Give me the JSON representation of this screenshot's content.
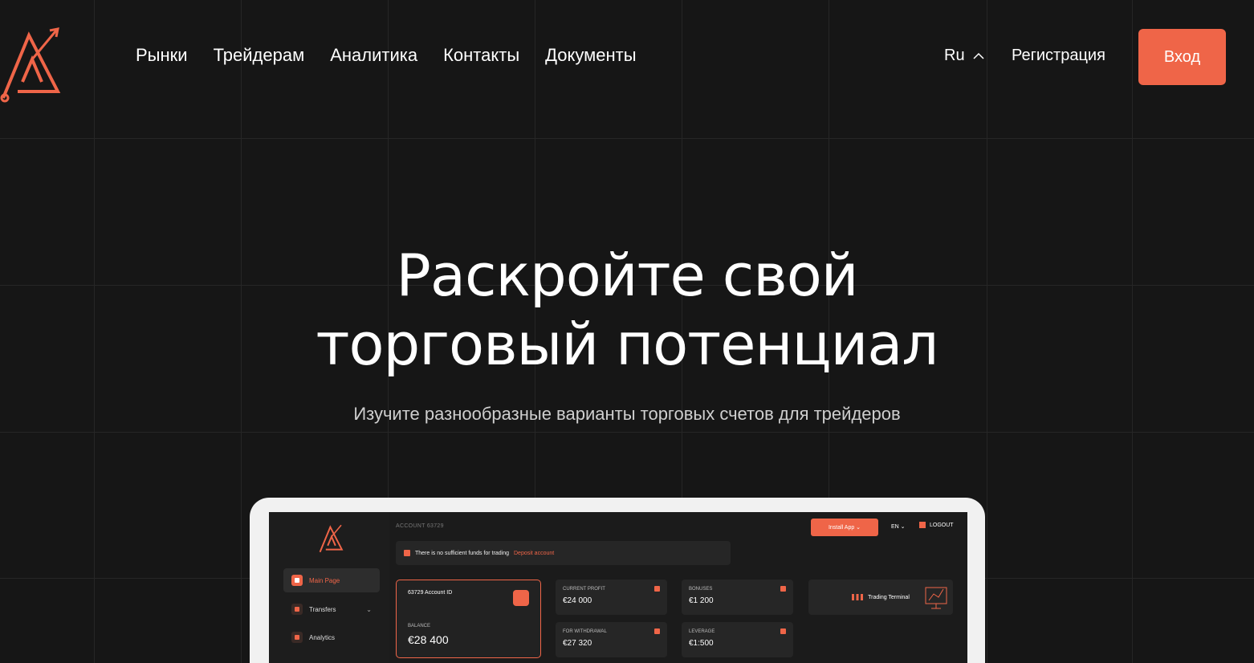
{
  "header": {
    "nav": [
      "Рынки",
      "Трейдерам",
      "Аналитика",
      "Контакты",
      "Документы"
    ],
    "language": "Ru",
    "register_label": "Регистрация",
    "login_label": "Вход"
  },
  "hero": {
    "title_line1": "Раскройте свой",
    "title_line2": "торговый потенциал",
    "subtitle": "Изучите разнообразные варианты торговых счетов для трейдеров"
  },
  "dashboard": {
    "account_label": "ACCOUNT 63729",
    "install_label": "Install App ⌄",
    "language": "EN ⌄",
    "logout_label": "LOGOUT",
    "warning_text": "There is no sufficient funds for trading",
    "warning_link": "Deposit account",
    "sidebar": [
      {
        "label": "Main Page"
      },
      {
        "label": "Transfers"
      },
      {
        "label": "Analytics"
      }
    ],
    "account_card": {
      "id": "63729 Account ID",
      "balance_label": "BALANCE",
      "balance_value": "€28 400"
    },
    "stats": [
      {
        "label": "CURRENT PROFIT",
        "value": "€24 000"
      },
      {
        "label": "BONUSES",
        "value": "€1 200"
      },
      {
        "label": "FOR WITHDRAWAL",
        "value": "€27 320"
      },
      {
        "label": "LEVERAGE",
        "value": "€1:500"
      }
    ],
    "terminal_label": "Trading Terminal"
  },
  "colors": {
    "accent": "#ef6548",
    "background": "#161616"
  }
}
